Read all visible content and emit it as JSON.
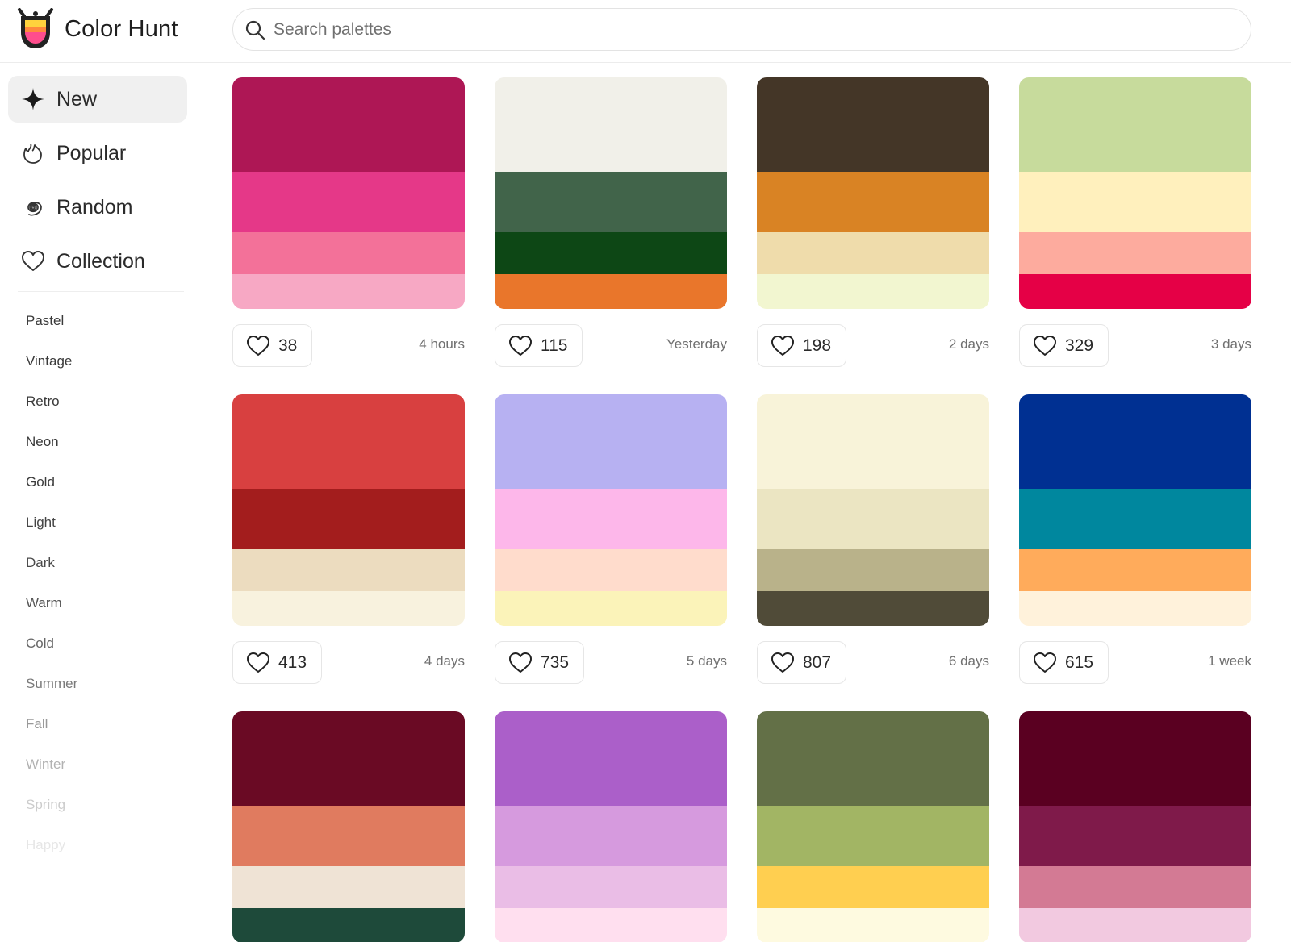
{
  "app": {
    "name": "Color Hunt"
  },
  "search": {
    "placeholder": "Search palettes"
  },
  "nav": [
    {
      "label": "New",
      "icon": "sparkle-icon",
      "active": true
    },
    {
      "label": "Popular",
      "icon": "flame-icon",
      "active": false
    },
    {
      "label": "Random",
      "icon": "spiral-icon",
      "active": false
    },
    {
      "label": "Collection",
      "icon": "heart-icon",
      "active": false
    }
  ],
  "tags": [
    {
      "label": "Pastel",
      "color": "#3a3a3a"
    },
    {
      "label": "Vintage",
      "color": "#3a3a3a"
    },
    {
      "label": "Retro",
      "color": "#3a3a3a"
    },
    {
      "label": "Neon",
      "color": "#3a3a3a"
    },
    {
      "label": "Gold",
      "color": "#3c3c3c"
    },
    {
      "label": "Light",
      "color": "#444444"
    },
    {
      "label": "Dark",
      "color": "#4a4a4a"
    },
    {
      "label": "Warm",
      "color": "#555555"
    },
    {
      "label": "Cold",
      "color": "#666666"
    },
    {
      "label": "Summer",
      "color": "#7a7a7a"
    },
    {
      "label": "Fall",
      "color": "#999999"
    },
    {
      "label": "Winter",
      "color": "#b2b2b2"
    },
    {
      "label": "Spring",
      "color": "#cccccc"
    },
    {
      "label": "Happy",
      "color": "#e6e6e6"
    }
  ],
  "palettes": [
    {
      "colors": [
        "#AE1755",
        "#E53888",
        "#F37199",
        "#F7A8C4"
      ],
      "likes": "38",
      "time": "4 hours"
    },
    {
      "colors": [
        "#F1F0E9",
        "#41644A",
        "#0D4715",
        "#E9762B"
      ],
      "likes": "115",
      "time": "Yesterday"
    },
    {
      "colors": [
        "#443627",
        "#D98324",
        "#EFDCAB",
        "#F2F6D0"
      ],
      "likes": "198",
      "time": "2 days"
    },
    {
      "colors": [
        "#C7DB9C",
        "#FFF0BD",
        "#FDAB9E",
        "#E50046"
      ],
      "likes": "329",
      "time": "3 days"
    },
    {
      "colors": [
        "#D84040",
        "#A31D1D",
        "#ECDCBF",
        "#F8F2DE"
      ],
      "likes": "413",
      "time": "4 days"
    },
    {
      "colors": [
        "#B7B1F2",
        "#FDB7EA",
        "#FFDCCC",
        "#FBF3B9"
      ],
      "likes": "735",
      "time": "5 days"
    },
    {
      "colors": [
        "#F8F3D9",
        "#EBE5C2",
        "#B9B28A",
        "#504B38"
      ],
      "likes": "807",
      "time": "6 days"
    },
    {
      "colors": [
        "#003092",
        "#00879E",
        "#FFAB5B",
        "#FFF2DB"
      ],
      "likes": "615",
      "time": "1 week"
    },
    {
      "colors": [
        "#6A0A24",
        "#E07B5F",
        "#EFE3D5",
        "#1E4A3A"
      ],
      "likes": "",
      "time": ""
    },
    {
      "colors": [
        "#AB5FC9",
        "#D69ADE",
        "#EABDE6",
        "#FFDFEF"
      ],
      "likes": "",
      "time": ""
    },
    {
      "colors": [
        "#637047",
        "#A2B564",
        "#FFCF50",
        "#FEFAE0"
      ],
      "likes": "",
      "time": ""
    },
    {
      "colors": [
        "#5A0021",
        "#7F1A4A",
        "#D37A94",
        "#F2C9E0"
      ],
      "likes": "",
      "time": ""
    }
  ]
}
